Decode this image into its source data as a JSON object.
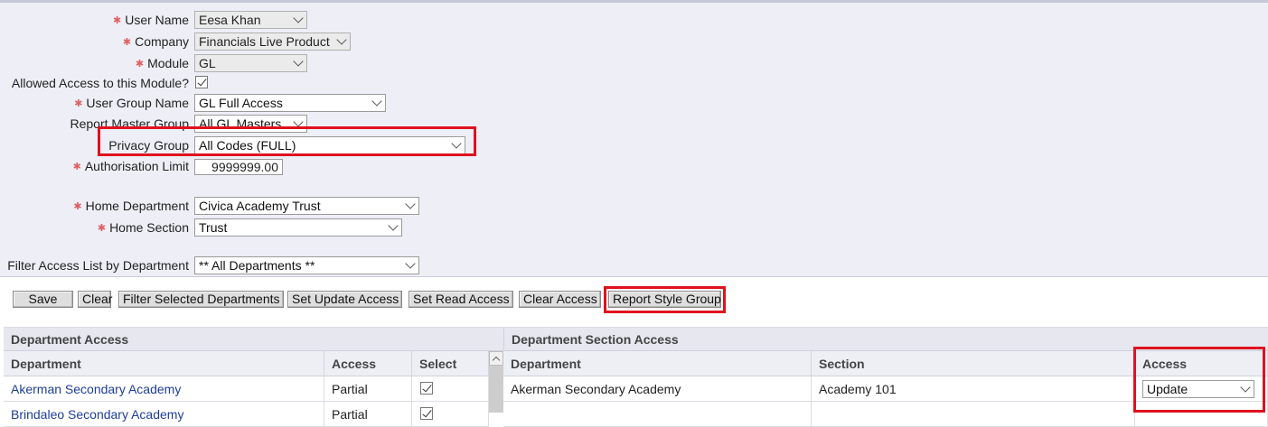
{
  "form": {
    "user_name": {
      "label": "User Name",
      "value": "Eesa Khan",
      "required": true
    },
    "company": {
      "label": "Company",
      "value": "Financials Live Product",
      "required": true
    },
    "module": {
      "label": "Module",
      "value": "GL",
      "required": true
    },
    "allowed_access": {
      "label": "Allowed Access to this Module?",
      "checked": true
    },
    "user_group_name": {
      "label": "User Group Name",
      "value": "GL Full Access",
      "required": true
    },
    "report_master_group": {
      "label": "Report Master Group",
      "value": "All GL Masters"
    },
    "privacy_group": {
      "label": "Privacy Group",
      "value": "All Codes (FULL)"
    },
    "authorisation_limit": {
      "label": "Authorisation Limit",
      "value": "9999999.00",
      "required": true
    },
    "home_department": {
      "label": "Home Department",
      "value": "Civica Academy Trust",
      "required": true
    },
    "home_section": {
      "label": "Home Section",
      "value": "Trust",
      "required": true
    },
    "filter_access": {
      "label": "Filter Access List by Department",
      "value": "** All Departments **"
    }
  },
  "toolbar": {
    "save": "Save",
    "clear": "Clear",
    "filter_selected": "Filter Selected Departments",
    "set_update": "Set Update Access",
    "set_read": "Set Read Access",
    "clear_access": "Clear Access",
    "report_style_group": "Report Style Group"
  },
  "department_access": {
    "title": "Department Access",
    "columns": [
      "Department",
      "Access",
      "Select"
    ],
    "rows": [
      {
        "department": "Akerman Secondary Academy",
        "access": "Partial",
        "selected": true
      },
      {
        "department": "Brindaleo Secondary Academy",
        "access": "Partial",
        "selected": true
      }
    ]
  },
  "section_access": {
    "title": "Department Section Access",
    "columns": [
      "Department",
      "Section",
      "Access"
    ],
    "rows": [
      {
        "department": "Akerman Secondary Academy",
        "section": "Academy 101",
        "access": "Update"
      }
    ]
  },
  "colors": {
    "panel_bg": "#eeeef7",
    "highlight": "#e0111e",
    "link": "#1f3d9a",
    "required_marker": "#e06060"
  },
  "icons": {
    "required": "asterisk-icon",
    "dropdown": "chevron-down-icon",
    "checkbox": "checkmark-icon"
  }
}
